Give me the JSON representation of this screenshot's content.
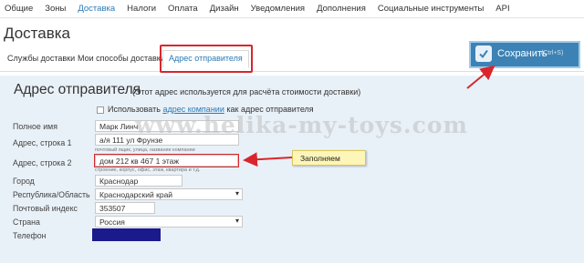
{
  "nav": {
    "items": [
      "Общие",
      "Зоны",
      "Доставка",
      "Налоги",
      "Оплата",
      "Дизайн",
      "Уведомления",
      "Дополнения",
      "Социальные инструменты",
      "API"
    ],
    "active": "Доставка"
  },
  "page": {
    "title": "Доставка"
  },
  "tabs": [
    "Службы доставки",
    "Мои способы доставки",
    "Адрес отправителя"
  ],
  "save": {
    "label": "Сохранить",
    "hint": "(Ctrl+S)"
  },
  "section": {
    "title": "Адрес отправителя",
    "note": "(Этот адрес используется для расчёта стоимости доставки)",
    "checkbox_prefix": "Использовать",
    "checkbox_link": "адрес компании",
    "checkbox_suffix": "как адрес отправителя"
  },
  "fields": {
    "name": {
      "label": "Полное имя",
      "value": "Марк Линч"
    },
    "addr1": {
      "label": "Адрес, строка 1",
      "value": "а/я 111  ул Фрунзе",
      "hint": "почтовый ящик, улица, название компании"
    },
    "addr2": {
      "label": "Адрес, строка 2",
      "value": "дом 212 кв 467 1 этаж",
      "hint": "строение, корпус, офис, этаж, квартира и т.д."
    },
    "city": {
      "label": "Город",
      "value": "Краснодар"
    },
    "region": {
      "label": "Республика/Область",
      "value": "Краснодарский край"
    },
    "zip": {
      "label": "Почтовый индекс",
      "value": "353507"
    },
    "country": {
      "label": "Страна",
      "value": "Россия"
    },
    "phone": {
      "label": "Телефон"
    }
  },
  "callout": {
    "text": "Заполняем"
  },
  "watermark": "www.helika-my-toys.com",
  "colors": {
    "accent": "#2a7ab8",
    "save_bg": "#3d82b4",
    "panel_bg": "#e9f1f8",
    "annotation_red": "#d9262c",
    "callout_bg": "#fdf6b8"
  }
}
